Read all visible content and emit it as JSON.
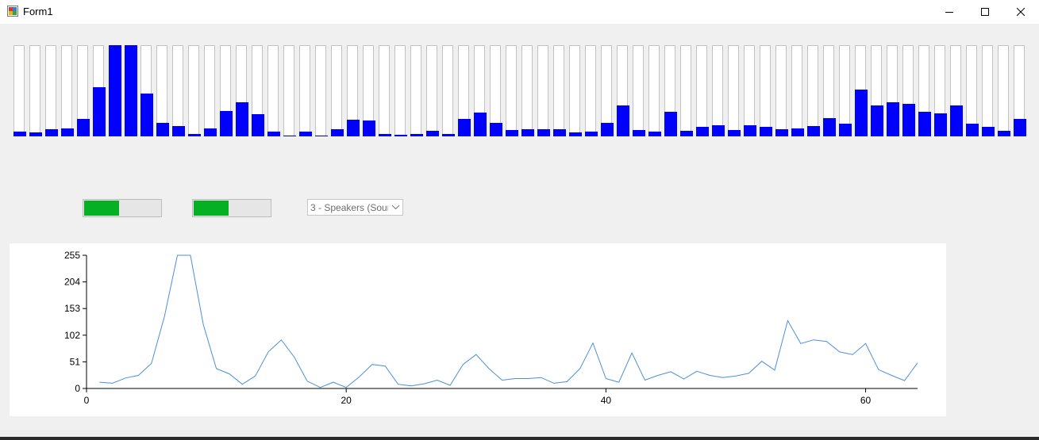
{
  "window": {
    "title": "Form1",
    "controls": [
      "minimize-icon",
      "maximize-icon",
      "close-icon"
    ]
  },
  "spectrum": {
    "bar_color": "#0000ff",
    "levels": [
      5,
      4,
      8,
      9,
      19,
      54,
      100,
      100,
      47,
      15,
      11,
      3,
      9,
      28,
      37,
      24,
      5,
      1,
      5,
      1,
      8,
      18,
      17,
      3,
      2,
      3,
      6,
      3,
      19,
      26,
      15,
      7,
      8,
      8,
      8,
      4,
      5,
      15,
      34,
      7,
      5,
      27,
      6,
      10,
      12,
      7,
      12,
      10,
      8,
      9,
      11,
      20,
      14,
      51,
      34,
      37,
      36,
      27,
      25,
      34,
      14,
      10,
      6,
      19
    ]
  },
  "levels": {
    "left_meter": 0.46,
    "right_meter": 0.46,
    "color": "#06b025"
  },
  "device_select": {
    "selected": "3 - Speakers (Sound"
  },
  "chart_data": {
    "type": "line",
    "line_color": "#4a90d9",
    "x": [
      1,
      2,
      3,
      4,
      5,
      6,
      7,
      8,
      9,
      10,
      11,
      12,
      13,
      14,
      15,
      16,
      17,
      18,
      19,
      20,
      21,
      22,
      23,
      24,
      25,
      26,
      27,
      28,
      29,
      30,
      31,
      32,
      33,
      34,
      35,
      36,
      37,
      38,
      39,
      40,
      41,
      42,
      43,
      44,
      45,
      46,
      47,
      48,
      49,
      50,
      51,
      52,
      53,
      54,
      55,
      56,
      57,
      58,
      59,
      60,
      61,
      62,
      63,
      64
    ],
    "y": [
      12,
      10,
      20,
      25,
      48,
      138,
      255,
      255,
      122,
      38,
      28,
      8,
      24,
      70,
      93,
      60,
      14,
      2,
      12,
      2,
      22,
      46,
      43,
      8,
      5,
      9,
      16,
      6,
      46,
      65,
      38,
      16,
      19,
      19,
      21,
      10,
      13,
      38,
      87,
      19,
      12,
      68,
      16,
      25,
      32,
      18,
      33,
      25,
      21,
      24,
      29,
      52,
      35,
      130,
      86,
      93,
      90,
      70,
      65,
      86,
      36,
      25,
      15,
      49
    ],
    "x_ticks": [
      "0",
      "20",
      "40",
      "60"
    ],
    "y_ticks": [
      "0",
      "51",
      "102",
      "153",
      "204",
      "255"
    ],
    "xlim": [
      0,
      64
    ],
    "ylim": [
      0,
      255
    ],
    "xlabel": "",
    "ylabel": "",
    "title": ""
  }
}
